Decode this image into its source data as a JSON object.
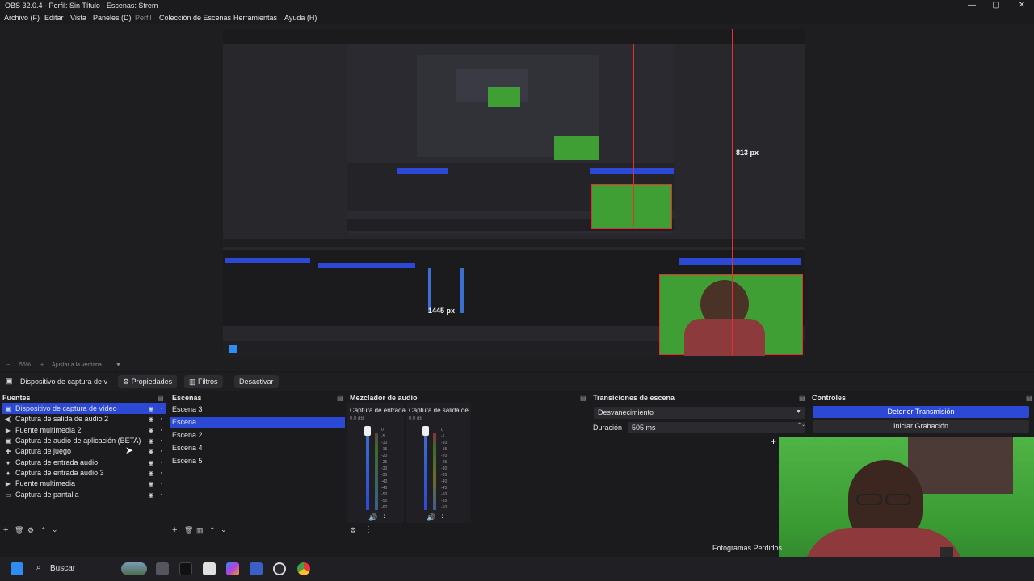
{
  "window": {
    "title": "OBS 32.0.4 - Perfil: Sin Título - Escenas: Strem",
    "controls": [
      "—",
      "▢",
      "✕"
    ]
  },
  "menu": {
    "items": [
      "Archivo (F)",
      "Editar",
      "Vista",
      "Paneles (D)",
      "Perfil",
      "Colección de Escenas",
      "Herramientas",
      "Ayuda (H)"
    ]
  },
  "preview": {
    "measure_vertical": "813 px",
    "measure_horizontal": "1445 px"
  },
  "zoom": {
    "level": "56%",
    "fit_label": "Ajustar a la ventana"
  },
  "source_toolbar": {
    "selected_source": "Dispositivo de captura de v",
    "properties": "Propiedades",
    "filters": "Filtros",
    "deactivate": "Desactivar"
  },
  "sources": {
    "title": "Fuentes",
    "items": [
      {
        "label": "Dispositivo de captura de vídeo",
        "icon": "camera-icon",
        "selected": true
      },
      {
        "label": "Captura de salida de audio 2",
        "icon": "speaker-icon",
        "selected": false
      },
      {
        "label": "Fuente multimedia 2",
        "icon": "play-icon",
        "selected": false
      },
      {
        "label": "Captura de audio de aplicación (BETA)",
        "icon": "app-audio-icon",
        "selected": false
      },
      {
        "label": "Captura de juego",
        "icon": "gamepad-icon",
        "selected": false
      },
      {
        "label": "Captura de entrada audio",
        "icon": "microphone-icon",
        "selected": false
      },
      {
        "label": "Captura de entrada audio 3",
        "icon": "microphone-icon",
        "selected": false
      },
      {
        "label": "Fuente multimedia",
        "icon": "play-icon",
        "selected": false
      },
      {
        "label": "Captura de pantalla",
        "icon": "monitor-icon",
        "selected": false
      }
    ]
  },
  "scenes": {
    "title": "Escenas",
    "items": [
      {
        "label": "Escena 3",
        "selected": false
      },
      {
        "label": "Escena",
        "selected": true
      },
      {
        "label": "Escena 2",
        "selected": false
      },
      {
        "label": "Escena 4",
        "selected": false
      },
      {
        "label": "Escena 5",
        "selected": false
      }
    ]
  },
  "mixer": {
    "title": "Mezclador de audio",
    "channels": [
      {
        "name": "Captura de entrada",
        "db": "0.0 dB"
      },
      {
        "name": "Captura de salida de",
        "db": "0.0 dB"
      }
    ],
    "scale": [
      "0",
      "-5",
      "-10",
      "-15",
      "-20",
      "-25",
      "-30",
      "-35",
      "-40",
      "-45",
      "-50",
      "-55",
      "-60"
    ]
  },
  "transitions": {
    "title": "Transiciones de escena",
    "type": "Desvanecimiento",
    "duration_label": "Duración",
    "duration_value": "505 ms"
  },
  "controls": {
    "title": "Controles",
    "stop_stream": "Detener Transmisión",
    "start_recording": "Iniciar Grabación"
  },
  "status": {
    "dropped_frames": "Fotogramas Perdidos"
  },
  "taskbar": {
    "search_placeholder": "Buscar"
  },
  "colors": {
    "accent": "#2c49d6",
    "selection": "#2c49d6",
    "measure_line": "#e53030",
    "green_screen": "#3f9f35"
  }
}
